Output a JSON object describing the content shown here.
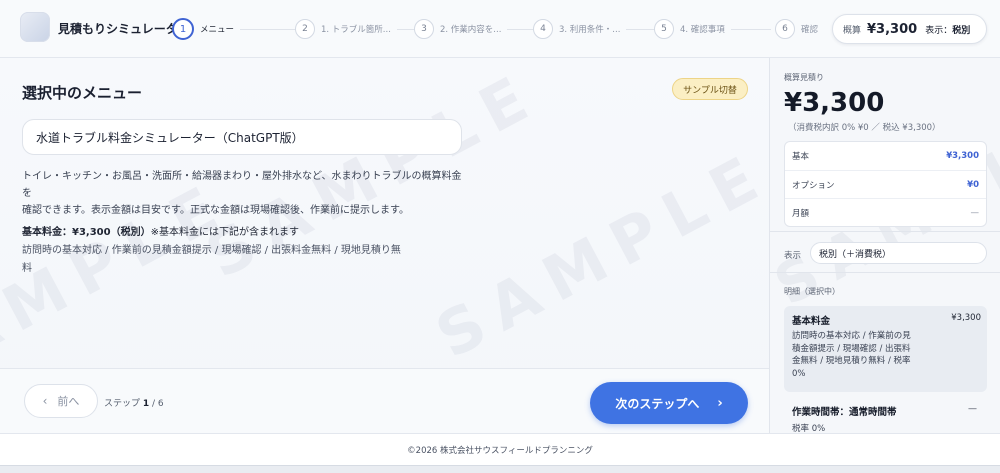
{
  "header": {
    "app_title": "見積もりシミュレーター",
    "steps": [
      {
        "num": "1",
        "label": "メニュー"
      },
      {
        "num": "2",
        "label": "1. トラブル箇所..."
      },
      {
        "num": "3",
        "label": "2. 作業内容を..."
      },
      {
        "num": "4",
        "label": "3. 利用条件・..."
      },
      {
        "num": "5",
        "label": "4. 確認事項"
      },
      {
        "num": "6",
        "label": "確認"
      }
    ],
    "estimate_label": "概算",
    "estimate_amount": "¥3,300",
    "display_mode_label": "表示：",
    "display_mode_value": "税別"
  },
  "main": {
    "section_title": "選択中のメニュー",
    "sample_button": "サンプル切替",
    "menu_value": "水道トラブル料金シミュレーター（ChatGPT版）",
    "description_lines": [
      "トイレ・キッチン・お風呂・洗面所・給湯器まわり・屋外排水など、水まわりトラブルの概算料金を",
      "確認できます。表示金額は目安です。正式な金額は現場確認後、作業前に提示します。"
    ],
    "base_fee_label": "基本料金：¥3,300（税別）",
    "base_fee_note": "※基本料金には下記が含まれます",
    "base_fee_items_lines": [
      "訪問時の基本対応 / 作業前の見積金額提示 / 現場確認 / 出張料金無料 / 現地見積り無",
      "料"
    ],
    "watermark": "SAMPLE",
    "prev_button": "前へ",
    "step_counter_prefix": "ステップ ",
    "step_current": "1",
    "step_total": " / 6",
    "next_button": "次のステップへ"
  },
  "sidebar": {
    "estimate_label": "概算見積り",
    "total": "¥3,300",
    "tax_note": "（消費税内訳 0% ¥0 ／ 税込 ¥3,300）",
    "rows": [
      {
        "label": "基本",
        "value": "¥3,300"
      },
      {
        "label": "オプション",
        "value": "¥0"
      },
      {
        "label": "月額",
        "value": "—"
      }
    ],
    "display_label": "表示",
    "display_value": "税別（＋消費税）",
    "details_label": "明細（選択中）",
    "details": [
      {
        "title": "基本料金",
        "price": "¥3,300",
        "desc_lines": [
          "訪問時の基本対応 / 作業前の見",
          "積金額提示 / 現場確認 / 出張料",
          "金無料 / 現地見積り無料 / 税率",
          "0%"
        ]
      },
      {
        "title": "作業時間帯：通常時間帯",
        "price": "—",
        "desc": "税率 0%"
      }
    ]
  },
  "footer": {
    "copyright": "©2026 株式会社サウスフィールドプランニング"
  }
}
